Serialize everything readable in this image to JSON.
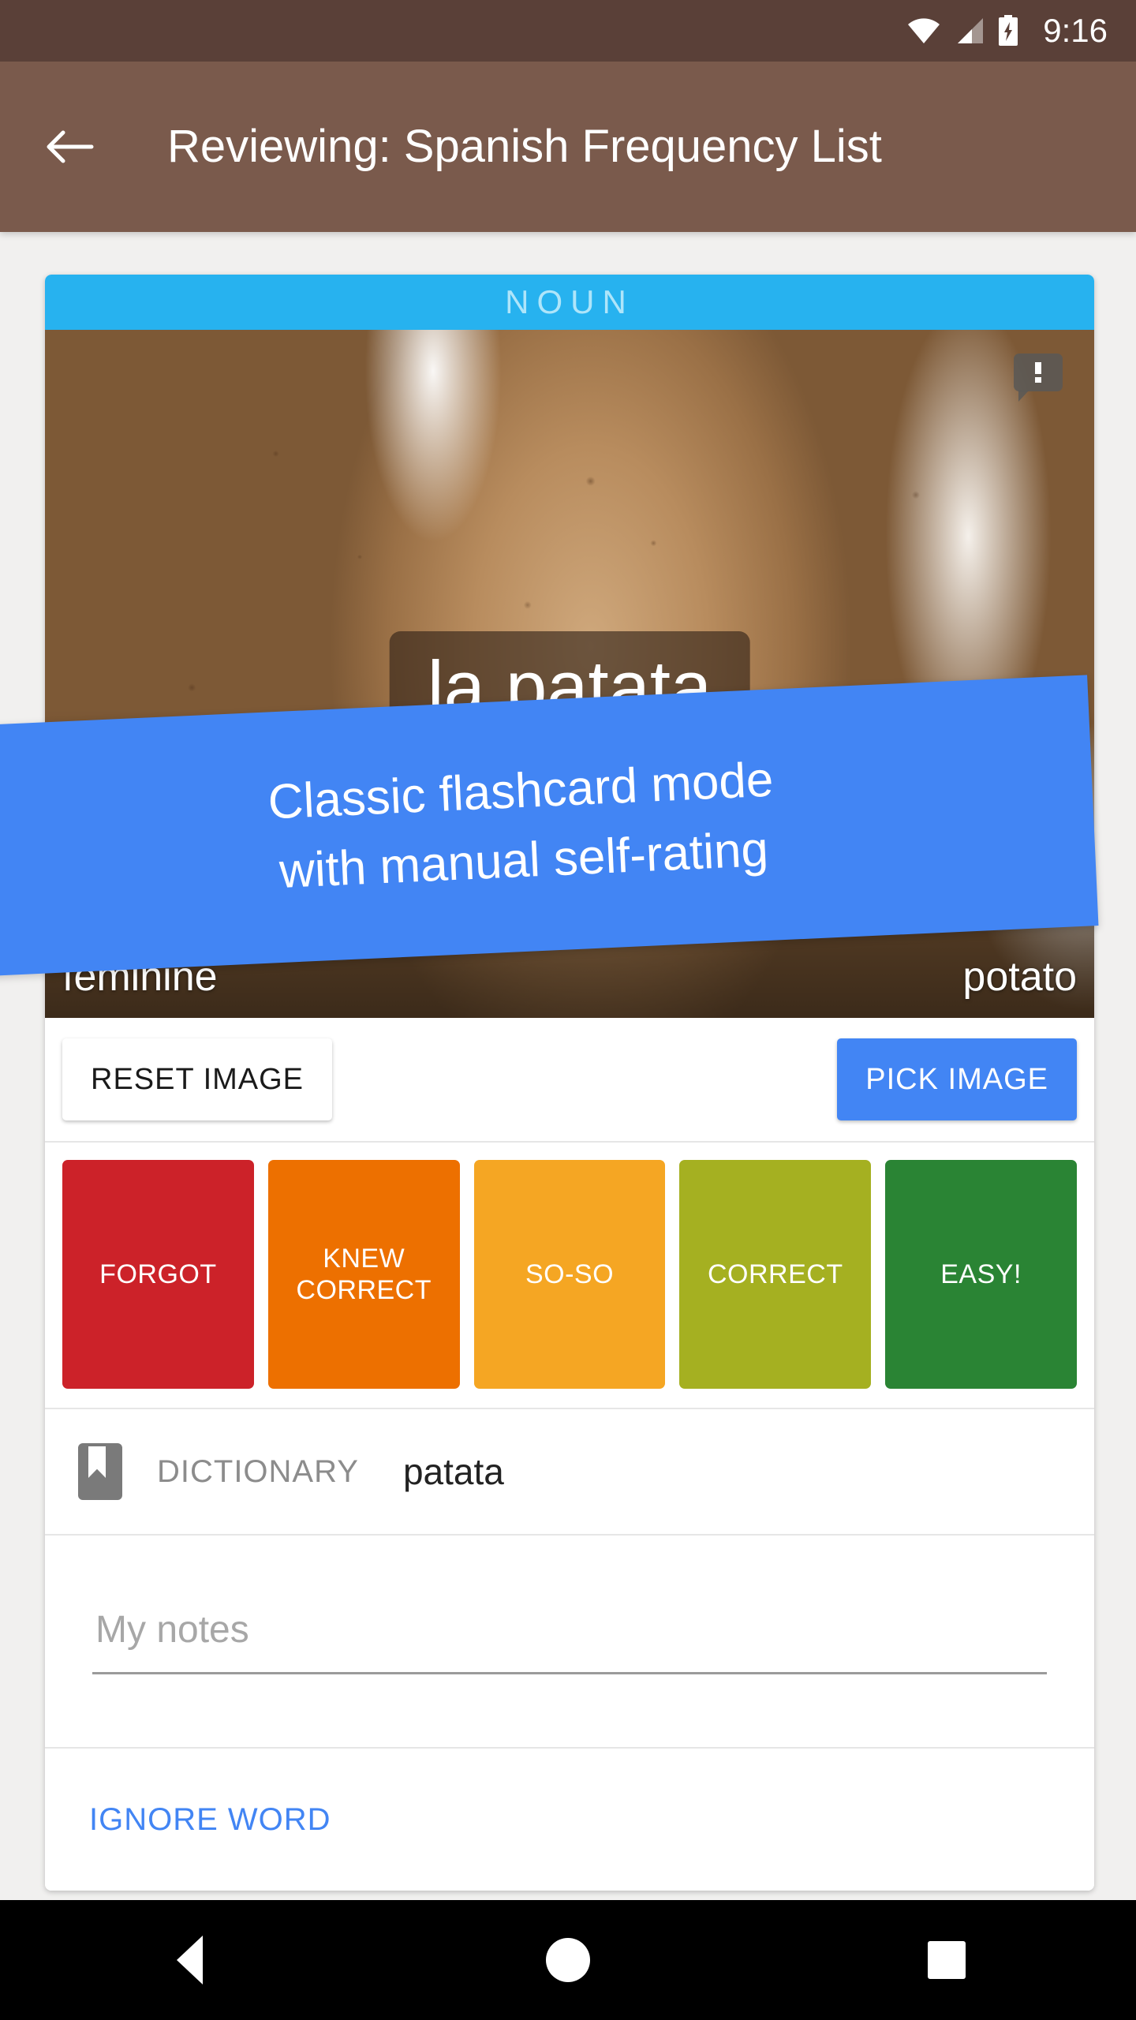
{
  "status_bar": {
    "time": "9:16",
    "icons": [
      "wifi-icon",
      "cell-signal-icon",
      "battery-charging-icon"
    ]
  },
  "app_bar": {
    "back_icon": "back-arrow-icon",
    "title": "Reviewing: Spanish Frequency List",
    "background_color": "#7a5a4c"
  },
  "card": {
    "part_of_speech": "NOUN",
    "pos_bar_color": "#27b2ef",
    "pos_text_color": "#aee5fa",
    "image": {
      "alt": "close-up photo of raw potatoes",
      "report_icon": "report-flag-icon"
    },
    "word": "la patata",
    "gender": "feminine",
    "translation": "potato",
    "image_buttons": {
      "reset_label": "RESET IMAGE",
      "pick_label": "PICK IMAGE",
      "pick_color": "#4285f4"
    },
    "ratings": [
      {
        "label": "FORGOT",
        "color": "#cc2229"
      },
      {
        "label": "KNEW\nCORRECT",
        "color": "#ed7000"
      },
      {
        "label": "SO-SO",
        "color": "#f5a623"
      },
      {
        "label": "CORRECT",
        "color": "#a5b021"
      },
      {
        "label": "EASY!",
        "color": "#2a8434"
      }
    ],
    "dictionary": {
      "icon": "bookmark-icon",
      "label": "DICTIONARY",
      "word": "patata"
    },
    "notes": {
      "placeholder": "My notes",
      "value": ""
    },
    "ignore": {
      "label": "IGNORE WORD",
      "color": "#4285f4"
    }
  },
  "tooltip": {
    "line1": "Classic flashcard mode",
    "line2": "with manual self-rating",
    "background_color": "#4285f4"
  },
  "nav_bar": {
    "items": [
      "back-triangle-icon",
      "home-circle-icon",
      "recents-square-icon"
    ]
  }
}
